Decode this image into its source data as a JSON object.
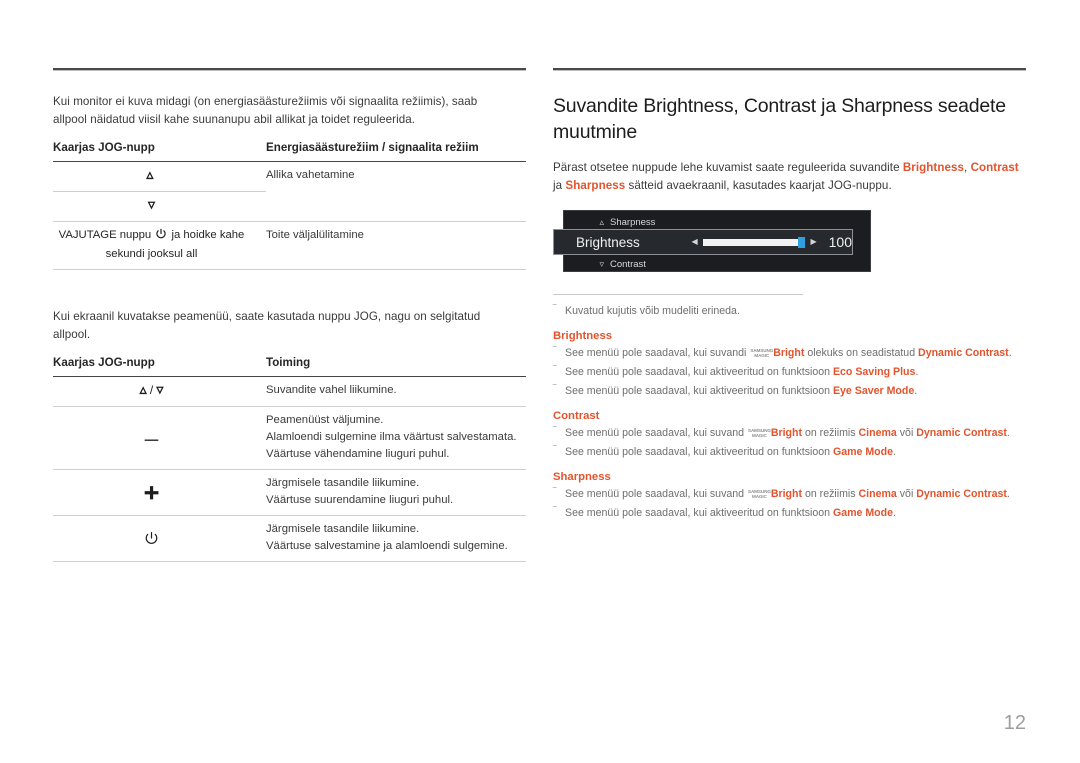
{
  "document": {
    "page_number": "12",
    "accent_color": "#e2542e"
  },
  "left_column": {
    "intro_paragraph": "Kui monitor ei kuva midagi (on energiasäästurežiimis või signaalita režiimis), saab allpool näidatud viisil kahe suunanupu abil allikat ja toidet reguleerida.",
    "table1": {
      "headers": [
        "Kaarjas JOG-nupp",
        "Energiasäästurežiim / signaalita režiim"
      ],
      "rows": [
        {
          "key_icon": "chevron-up-icon",
          "key_text": "",
          "action": "Allika vahetamine"
        },
        {
          "key_icon": "chevron-down-icon",
          "key_text": "",
          "action": ""
        },
        {
          "key_icon": "power-icon",
          "key_text_before": "VAJUTAGE nuppu",
          "key_text_after": "ja hoidke kahe sekundi jooksul all",
          "action": "Toite väljalülitamine"
        }
      ]
    },
    "intro_paragraph2": "Kui ekraanil kuvatakse peamenüü, saate kasutada nuppu JOG, nagu on selgitatud allpool.",
    "table2": {
      "headers": [
        "Kaarjas JOG-nupp",
        "Toiming"
      ],
      "rows": [
        {
          "key_icon": "chevron-up-down-icon",
          "actions": [
            "Suvandite vahel liikumine."
          ]
        },
        {
          "key_icon": "minus-icon",
          "actions": [
            "Peamenüüst väljumine.",
            "Alamloendi sulgemine ilma väärtust salvestamata.",
            "Väärtuse vähendamine liuguri puhul."
          ]
        },
        {
          "key_icon": "plus-icon",
          "actions": [
            "Järgmisele tasandile liikumine.",
            "Väärtuse suurendamine liuguri puhul."
          ]
        },
        {
          "key_icon": "power-icon",
          "actions": [
            "Järgmisele tasandile liikumine.",
            "Väärtuse salvestamine ja alamloendi sulgemine."
          ]
        }
      ]
    }
  },
  "right_column": {
    "title": "Suvandite Brightness, Contrast ja Sharpness seadete muutmine",
    "intro": {
      "part1": "Pärast otsetee nuppude lehe kuvamist saate reguleerida suvandite ",
      "link1": "Brightness",
      "sep1": ", ",
      "link2": "Contrast",
      "sep2": " ja ",
      "link3": "Sharpness",
      "part2": " sätteid avaekraanil, kasutades kaarjat JOG-nuppu."
    },
    "osd": {
      "top_item": "Sharpness",
      "top_arrow": "chevron-up-icon",
      "selected_item": "Brightness",
      "selected_value": "100",
      "left_arrow": "triangle-left-icon",
      "right_arrow": "triangle-right-icon",
      "bottom_item": "Contrast",
      "bottom_arrow": "chevron-down-icon"
    },
    "notes": {
      "general": "Kuvatud kujutis võib mudeliti erineda.",
      "sections": [
        {
          "heading": "Brightness",
          "items": [
            {
              "pre": "See menüü pole saadaval, kui suvandi ",
              "magic": true,
              "bright": "Bright",
              "mid": " olekuks on seadistatud ",
              "accent": "Dynamic Contrast",
              "post": "."
            },
            {
              "pre": "See menüü pole saadaval, kui aktiveeritud on funktsioon ",
              "magic": false,
              "accent": "Eco Saving Plus",
              "post": "."
            },
            {
              "pre": "See menüü pole saadaval, kui aktiveeritud on funktsioon ",
              "magic": false,
              "accent": "Eye Saver Mode",
              "post": "."
            }
          ]
        },
        {
          "heading": "Contrast",
          "items": [
            {
              "pre": "See menüü pole saadaval, kui suvand ",
              "magic": true,
              "bright": "Bright",
              "mid": " on režiimis ",
              "accent": "Cinema",
              "mid2": " või ",
              "accent2": "Dynamic Contrast",
              "post": "."
            },
            {
              "pre": "See menüü pole saadaval, kui aktiveeritud on funktsioon ",
              "magic": false,
              "accent": "Game Mode",
              "post": "."
            }
          ]
        },
        {
          "heading": "Sharpness",
          "items": [
            {
              "pre": "See menüü pole saadaval, kui suvand ",
              "magic": true,
              "bright": "Bright",
              "mid": " on režiimis ",
              "accent": "Cinema",
              "mid2": " või ",
              "accent2": "Dynamic Contrast",
              "post": "."
            },
            {
              "pre": "See menüü pole saadaval, kui aktiveeritud on funktsioon ",
              "magic": false,
              "accent": "Game Mode",
              "post": "."
            }
          ]
        }
      ],
      "magic_logo": {
        "line1": "SAMSUNG",
        "line2": "MAGIC"
      },
      "dash_marker": "‾"
    }
  }
}
